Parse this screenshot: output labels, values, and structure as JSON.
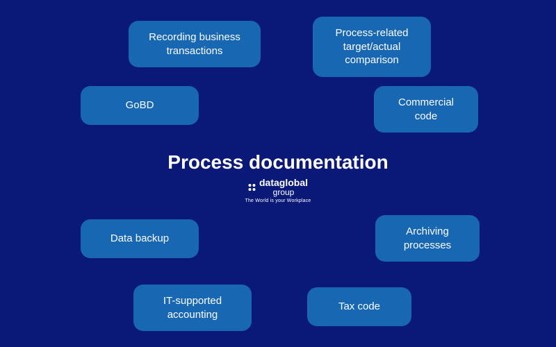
{
  "center": {
    "title": "Process documentation"
  },
  "brand": {
    "name": "dataglobal",
    "sub": "group",
    "tagline": "The World is your Workplace"
  },
  "nodes": [
    {
      "label": "Recording business transactions"
    },
    {
      "label": "Process-related target/actual comparison"
    },
    {
      "label": "GoBD"
    },
    {
      "label": "Commercial code"
    },
    {
      "label": "Data backup"
    },
    {
      "label": "Archiving processes"
    },
    {
      "label": "IT-supported accounting"
    },
    {
      "label": "Tax code"
    }
  ]
}
